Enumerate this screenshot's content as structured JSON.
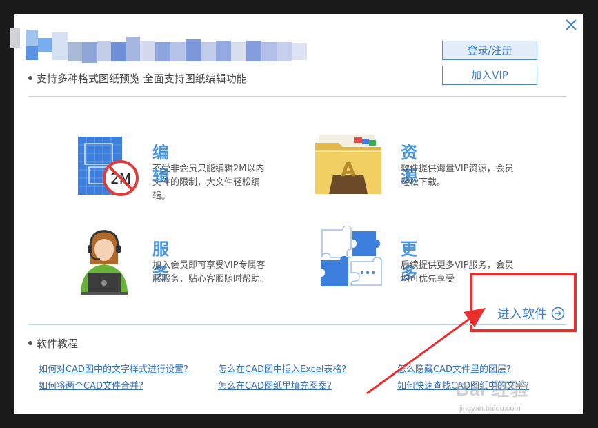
{
  "header": {
    "tagline": "支持多种格式图纸预览 全面支持图纸编辑功能",
    "login_label": "登录/注册",
    "vip_label": "加入VIP"
  },
  "features": [
    {
      "title": "编辑",
      "desc": "不受非会员只能编辑2M以内文件的限制，大文件轻松编辑。",
      "icon_text": "2M",
      "icon": "blueprint-no-2m-icon"
    },
    {
      "title": "资源",
      "desc": "软件提供海量VIP资源，会员轻松下载。",
      "icon_text": "A",
      "icon": "folder-archive-icon"
    },
    {
      "title": "服务",
      "desc": "加入会员即可享受VIP专属客服服务，贴心客服随时帮助。",
      "icon": "customer-service-icon"
    },
    {
      "title": "更多",
      "desc": "后续提供更多VIP服务，会员均可优先享受",
      "icon": "puzzle-icon"
    }
  ],
  "enter_software_label": "进入软件",
  "tutorials": {
    "heading": "软件教程",
    "links": [
      "如何对CAD图中的文字样式进行设置?",
      "怎么在CAD图中插入Excel表格?",
      "怎么隐藏CAD文件里的图层?",
      "如何将两个CAD文件合并?",
      "怎么在CAD图纸里填充图案?",
      "如何快速查找CAD图纸中的文字?"
    ]
  },
  "watermark": {
    "brand": "Bai 经验",
    "url": "jingyan.baidu.com"
  },
  "colors": {
    "accent": "#4a95e0",
    "link": "#2f6fc2",
    "highlight": "#ee2d2d"
  }
}
